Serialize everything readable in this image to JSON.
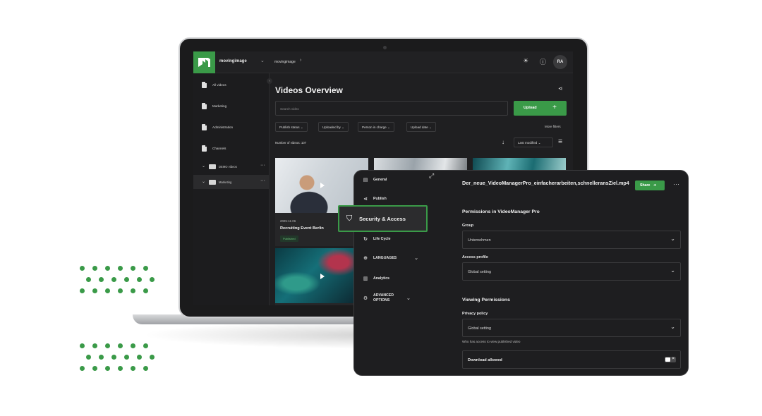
{
  "app": {
    "brand": "movingimage",
    "breadcrumb": "movingimage",
    "avatar_initials": "RA",
    "accent_color": "#3a9a48"
  },
  "sidebar": {
    "items": [
      {
        "label": "All videos",
        "icon": "document-icon"
      },
      {
        "label": "Marketing",
        "icon": "document-icon"
      },
      {
        "label": "Administration",
        "icon": "document-icon"
      },
      {
        "label": "Channels",
        "icon": "document-icon"
      }
    ],
    "folders": [
      {
        "label": "DEMO videos",
        "icon": "folder-icon"
      },
      {
        "label": "Marketing",
        "icon": "folder-icon",
        "active": true
      }
    ]
  },
  "main": {
    "title": "Videos Overview",
    "search_placeholder": "Search video",
    "upload_label": "Upload",
    "filters": [
      "Publish status",
      "Uploaded by",
      "Person in charge",
      "Upload date"
    ],
    "more_filters": "More filters",
    "count_label": "Number of videos: 107",
    "sort_label": "Last modified",
    "cards": [
      {
        "date": "2025-11-06",
        "title": "Recruiting Event Berlin",
        "status": "Published"
      }
    ]
  },
  "panel": {
    "nav": [
      {
        "label": "General",
        "icon": "file-icon"
      },
      {
        "label": "Publish",
        "icon": "share-icon"
      },
      {
        "label": "Security & Access",
        "icon": "shield-icon",
        "active": true
      },
      {
        "label": "Life Cycle",
        "icon": "cycle-icon"
      },
      {
        "label": "LANGUAGES",
        "icon": "globe-icon"
      },
      {
        "label": "Analytics",
        "icon": "chart-icon"
      },
      {
        "label": "ADVANCED OPTIONS",
        "icon": "settings-icon"
      }
    ],
    "file_title": "Der_neue_VideoManagerPro_einfacherarbeiten,schnelleransZiel.mp4",
    "share_label": "Share",
    "permissions_heading": "Permissions in VideoManager Pro",
    "group_label": "Group",
    "group_value": "Unternehmen",
    "access_profile_label": "Access profile",
    "access_profile_value": "Global setting",
    "viewing_heading": "Viewing Permissions",
    "privacy_label": "Privacy policy",
    "privacy_value": "Global setting",
    "privacy_help": "Who has access to view published video",
    "download_label": "Download allowed"
  }
}
